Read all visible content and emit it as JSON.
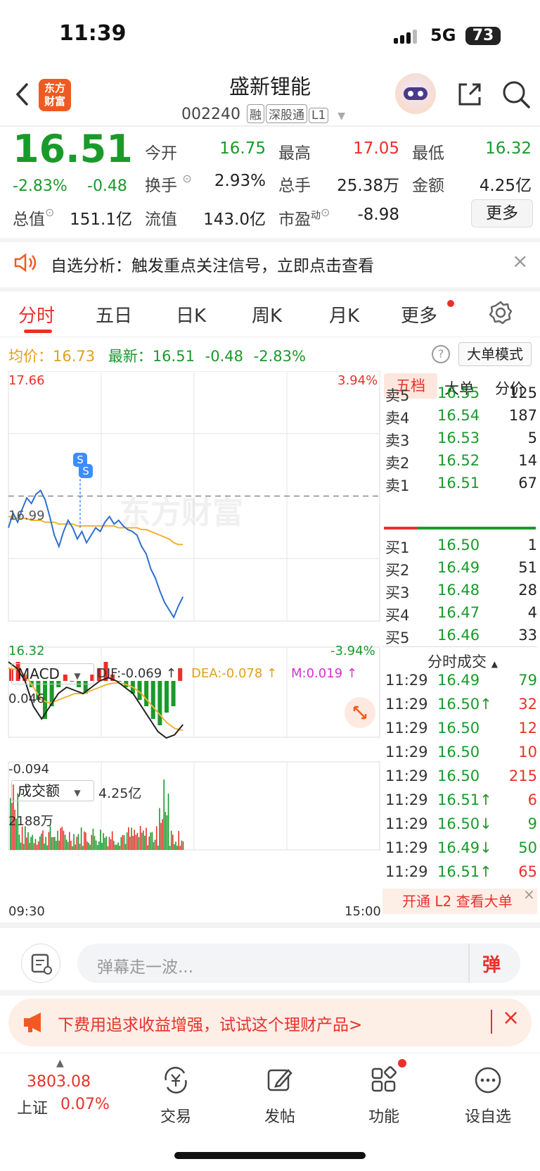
{
  "status": {
    "time": "11:39",
    "network": "5G",
    "battery": "73"
  },
  "header": {
    "logo_line1": "东方",
    "logo_line2": "财富",
    "title": "盛新锂能",
    "code": "002240",
    "tags": [
      "融",
      "深股通",
      "L1"
    ]
  },
  "quote": {
    "price": "16.51",
    "change_pct": "-2.83%",
    "change": "-0.48",
    "open_label": "今开",
    "open": "16.75",
    "high_label": "最高",
    "high": "17.05",
    "low_label": "最低",
    "low": "16.32",
    "turnover_label": "换手",
    "turnover": "2.93%",
    "volume_label": "总手",
    "volume": "25.38万",
    "amount_label": "金额",
    "amount": "4.25亿",
    "mcap_label": "总值",
    "mcap": "151.1亿",
    "float_label": "流值",
    "float": "143.0亿",
    "pe_label": "市盈",
    "pe_sup": "动",
    "pe": "-8.98",
    "more": "更多"
  },
  "notice": {
    "text": "自选分析：触发重点关注信号，立即点击查看"
  },
  "tabs": [
    "分时",
    "五日",
    "日K",
    "周K",
    "月K",
    "更多"
  ],
  "legend": {
    "avg_label": "均价：",
    "avg": "16.73",
    "last_label": "最新：",
    "last": "16.51",
    "chg": "-0.48",
    "pct": "-2.83%",
    "bigorder_mode": "大单模式"
  },
  "chart_data": {
    "type": "line",
    "y_top": "17.66",
    "y_mid": "16.99",
    "y_bottom": "16.32",
    "pct_top": "3.94%",
    "pct_bottom": "-3.94%",
    "ylim": [
      16.32,
      17.66
    ],
    "prev_close": 16.99,
    "x_start": "09:30",
    "x_end": "15:00",
    "watermark": "东方财富",
    "price_series": [
      16.82,
      16.9,
      16.85,
      16.92,
      16.98,
      16.95,
      17.0,
      17.02,
      16.97,
      16.88,
      16.78,
      16.72,
      16.8,
      16.86,
      16.82,
      16.76,
      16.8,
      16.74,
      16.78,
      16.82,
      16.8,
      16.85,
      16.88,
      16.84,
      16.86,
      16.83,
      16.81,
      16.8,
      16.78,
      16.72,
      16.68,
      16.6,
      16.55,
      16.48,
      16.42,
      16.38,
      16.34,
      16.4,
      16.45
    ],
    "avg_series": [
      16.88,
      16.88,
      16.87,
      16.87,
      16.87,
      16.86,
      16.86,
      16.86,
      16.85,
      16.85,
      16.85,
      16.84,
      16.84,
      16.84,
      16.84,
      16.83,
      16.83,
      16.83,
      16.83,
      16.83,
      16.83,
      16.83,
      16.83,
      16.83,
      16.82,
      16.82,
      16.82,
      16.82,
      16.82,
      16.81,
      16.81,
      16.8,
      16.79,
      16.78,
      16.77,
      16.76,
      16.74,
      16.73,
      16.73
    ],
    "macd": {
      "label": "MACD",
      "dif": "DIF:-0.069 ↑",
      "dea": "DEA:-0.078 ↑",
      "m": "M:0.019 ↑",
      "top": "0.046",
      "bottom": "-0.094",
      "bars": [
        0.02,
        0.03,
        0.01,
        -0.01,
        -0.03,
        -0.06,
        -0.04,
        -0.01,
        0.01,
        0.0,
        -0.01,
        -0.02,
        0.01,
        0.02,
        0.03,
        0.01,
        0.0,
        -0.01,
        -0.02,
        -0.03,
        -0.04,
        -0.06,
        -0.07,
        -0.05,
        -0.04,
        0.02
      ]
    },
    "volume": {
      "label": "成交额",
      "total": "4.25亿",
      "top": "2188万"
    }
  },
  "orderbook": {
    "tabs": [
      "五档",
      "大单",
      "分价"
    ],
    "asks": [
      {
        "label": "卖5",
        "price": "16.55",
        "vol": "125"
      },
      {
        "label": "卖4",
        "price": "16.54",
        "vol": "187"
      },
      {
        "label": "卖3",
        "price": "16.53",
        "vol": "5"
      },
      {
        "label": "卖2",
        "price": "16.52",
        "vol": "14"
      },
      {
        "label": "卖1",
        "price": "16.51",
        "vol": "67"
      }
    ],
    "bids": [
      {
        "label": "买1",
        "price": "16.50",
        "vol": "1"
      },
      {
        "label": "买2",
        "price": "16.49",
        "vol": "51"
      },
      {
        "label": "买3",
        "price": "16.48",
        "vol": "28"
      },
      {
        "label": "买4",
        "price": "16.47",
        "vol": "4"
      },
      {
        "label": "买5",
        "price": "16.46",
        "vol": "33"
      }
    ]
  },
  "ticks": {
    "title": "分时成交",
    "rows": [
      {
        "time": "11:29",
        "price": "16.49",
        "dir": "",
        "vol": "79",
        "color": "green",
        "volcolor": "green"
      },
      {
        "time": "11:29",
        "price": "16.50↑",
        "dir": "",
        "vol": "32",
        "color": "green",
        "volcolor": "red"
      },
      {
        "time": "11:29",
        "price": "16.50",
        "dir": "",
        "vol": "12",
        "color": "green",
        "volcolor": "red"
      },
      {
        "time": "11:29",
        "price": "16.50",
        "dir": "",
        "vol": "10",
        "color": "green",
        "volcolor": "red"
      },
      {
        "time": "11:29",
        "price": "16.50",
        "dir": "",
        "vol": "215",
        "color": "green",
        "volcolor": "red"
      },
      {
        "time": "11:29",
        "price": "16.51↑",
        "dir": "",
        "vol": "6",
        "color": "green",
        "volcolor": "red"
      },
      {
        "time": "11:29",
        "price": "16.50↓",
        "dir": "",
        "vol": "9",
        "color": "green",
        "volcolor": "green"
      },
      {
        "time": "11:29",
        "price": "16.49↓",
        "dir": "",
        "vol": "50",
        "color": "green",
        "volcolor": "green"
      },
      {
        "time": "11:29",
        "price": "16.51↑",
        "dir": "",
        "vol": "65",
        "color": "green",
        "volcolor": "red"
      }
    ],
    "l2_link": "开通 L2 查看大单"
  },
  "comment": {
    "placeholder": "弹幕走一波...",
    "send": "弹"
  },
  "ad": {
    "text": "下费用追求收益增强，试试这个理财产品>"
  },
  "bottom_nav": {
    "index_value": "3803.08",
    "index_name": "上证",
    "index_pct": "0.07%",
    "items": [
      "交易",
      "发帖",
      "功能",
      "设自选"
    ]
  }
}
